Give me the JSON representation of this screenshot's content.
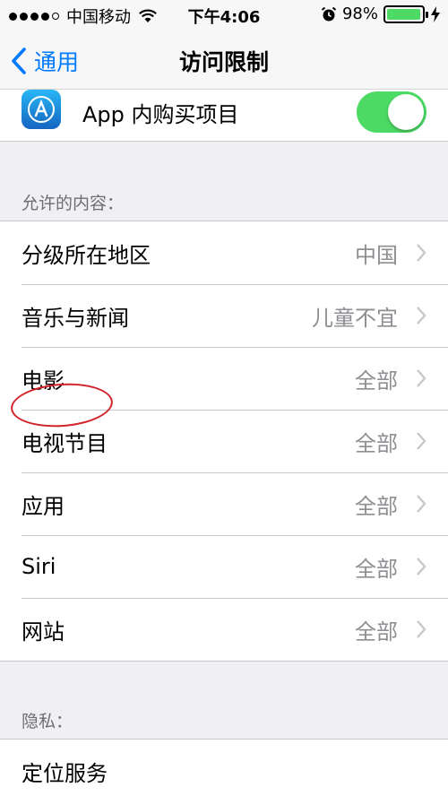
{
  "status": {
    "carrier": "中国移动",
    "time": "下午4:06",
    "battery": "98%",
    "battery_level": 0.98
  },
  "nav": {
    "back_label": "通用",
    "title": "访问限制"
  },
  "in_app_purchase": {
    "label": "App 内购买项目",
    "enabled": true
  },
  "allowed_content": {
    "header": "允许的内容：",
    "items": [
      {
        "label": "分级所在地区",
        "value": "中国"
      },
      {
        "label": "音乐与新闻",
        "value": "儿童不宜"
      },
      {
        "label": "电影",
        "value": "全部"
      },
      {
        "label": "电视节目",
        "value": "全部"
      },
      {
        "label": "应用",
        "value": "全部"
      },
      {
        "label": "Siri",
        "value": "全部"
      },
      {
        "label": "网站",
        "value": "全部"
      }
    ]
  },
  "privacy": {
    "header": "隐私：",
    "items": [
      {
        "label": "定位服务"
      }
    ]
  },
  "colors": {
    "accent": "#007aff",
    "toggle_on": "#4cd964",
    "annotation": "#d2232a",
    "background": "#efeff4"
  }
}
